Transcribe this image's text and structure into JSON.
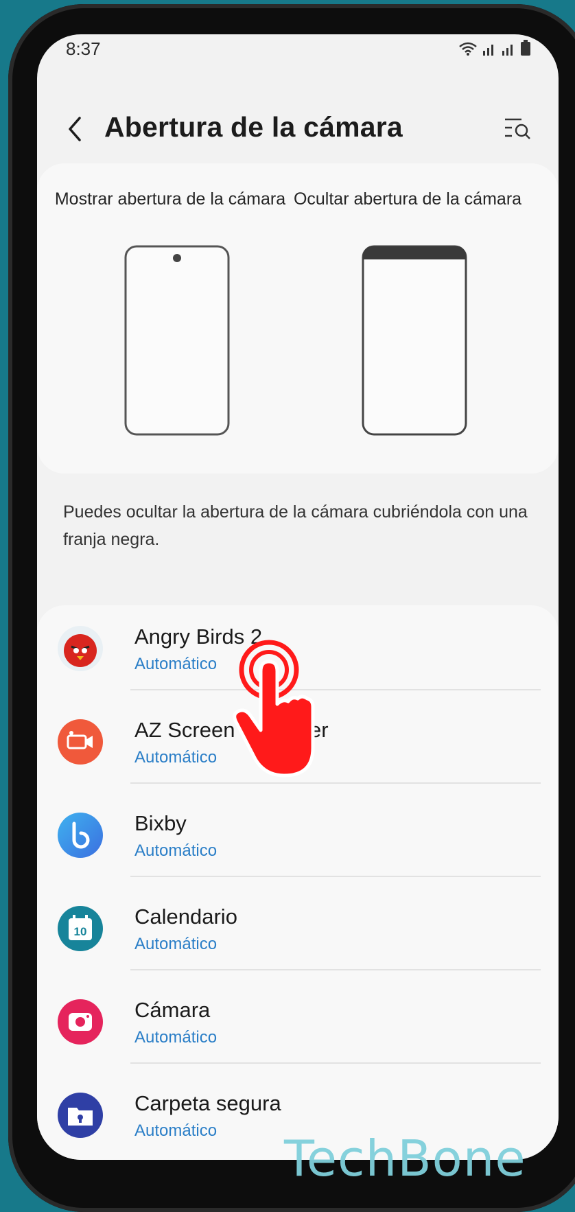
{
  "status_bar": {
    "time": "8:37"
  },
  "header": {
    "title": "Abertura de la cámara"
  },
  "preview": {
    "show_label": "Mostrar abertura de la cámara",
    "hide_label": "Ocultar abertura de la cámara"
  },
  "description": "Puedes ocultar la abertura de la cámara cubriéndola con una franja negra.",
  "apps": [
    {
      "name": "Angry Birds 2",
      "status": "Automático",
      "icon": "angry-birds-icon"
    },
    {
      "name": "AZ Screen Recorder",
      "status": "Automático",
      "icon": "az-screen-recorder-icon"
    },
    {
      "name": "Bixby",
      "status": "Automático",
      "icon": "bixby-icon"
    },
    {
      "name": "Calendario",
      "status": "Automático",
      "icon": "calendar-icon"
    },
    {
      "name": "Cámara",
      "status": "Automático",
      "icon": "camera-icon"
    },
    {
      "name": "Carpeta segura",
      "status": "Automático",
      "icon": "secure-folder-icon"
    }
  ],
  "calendar_day": "10",
  "watermark": "TechBone",
  "colors": {
    "accent": "#2a7ec7",
    "background": "#17798a",
    "tap_indicator": "#ff1a1a"
  }
}
